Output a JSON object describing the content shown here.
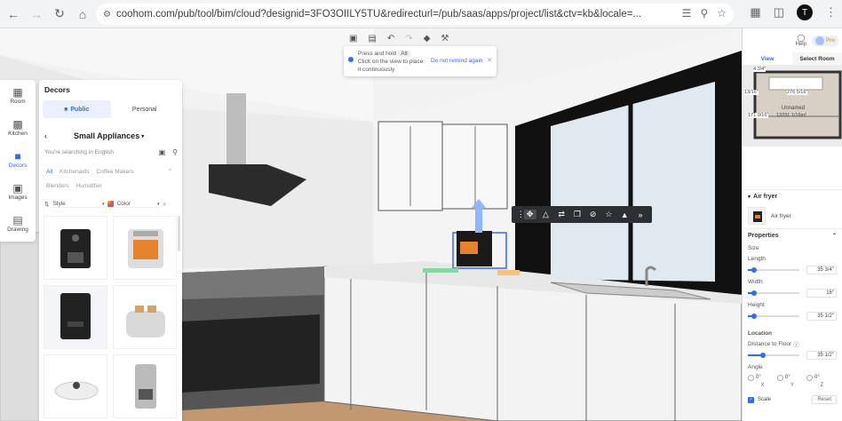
{
  "browser": {
    "url": "coohom.com/pub/tool/bim/cloud?designid=3FO3OIILY5TU&redirecturl=/pub/saas/apps/project/list&ctv=kb&locale=...",
    "profile_initial": "T"
  },
  "top_toolbar": {
    "tip_text": "Press and hold",
    "tip_key": "Alt",
    "tip_rest": "Click on the view to place it continuously",
    "tip_dismiss": "Do not remind again"
  },
  "left_rail": {
    "items": [
      {
        "label": "Room",
        "icon": "room-icon"
      },
      {
        "label": "Kitchen",
        "icon": "kitchen-icon"
      },
      {
        "label": "Decors",
        "icon": "decors-icon"
      },
      {
        "label": "Images",
        "icon": "images-icon"
      },
      {
        "label": "Drawing",
        "icon": "drawing-icon"
      }
    ],
    "active": "Decors"
  },
  "decors_panel": {
    "title": "Decors",
    "tabs": [
      "Public",
      "Personal"
    ],
    "active_tab": "Public",
    "category": "Small Appliances",
    "search_placeholder": "You're searching in English",
    "sub_tabs": [
      "All",
      "Kitchenaids",
      "Coffee Makers",
      "Blenders",
      "Humidifier"
    ],
    "active_sub_tab": "All",
    "filters": {
      "style": "Style",
      "color": "Color"
    },
    "items": [
      "coffee-machine",
      "air-fryer",
      "air-fryer-black",
      "toaster",
      "robot-vacuum",
      "coffee-maker"
    ]
  },
  "object_toolbar": [
    "move",
    "mirror",
    "replace",
    "duplicate",
    "hide",
    "favorite",
    "delete",
    "more"
  ],
  "right_panel": {
    "help_label": "Help",
    "pro_label": "Pro",
    "view_tabs": [
      "View",
      "Select Room"
    ],
    "minimap": {
      "dim_top": "4 3/4\"",
      "dim_left": "13/16\"",
      "dim_mid": "276 5/16\"",
      "room_name": "Unnamed",
      "room_area": "13231 1/16m²",
      "dim_bottom": "171 9/16\""
    },
    "object_name": "Air fryer",
    "object_label": "Air fryer",
    "properties_title": "Properties",
    "size_label": "Size",
    "length_label": "Length",
    "length_value": "35 3/4\"",
    "length_fill": 0.12,
    "width_label": "Width",
    "width_value": "16\"",
    "width_fill": 0.12,
    "height_label": "Height",
    "height_value": "35 1/2\"",
    "height_fill": 0.12,
    "location_label": "Location",
    "distance_label": "Distance to Floor",
    "distance_value": "35 1/2\"",
    "distance_fill": 0.3,
    "angle_label": "Angle",
    "angle_x": "0°",
    "angle_y": "0°",
    "angle_z": "0°",
    "axis_x": "X",
    "axis_y": "Y",
    "axis_z": "Z",
    "scale_label": "Scale",
    "reset_label": "Reset"
  }
}
